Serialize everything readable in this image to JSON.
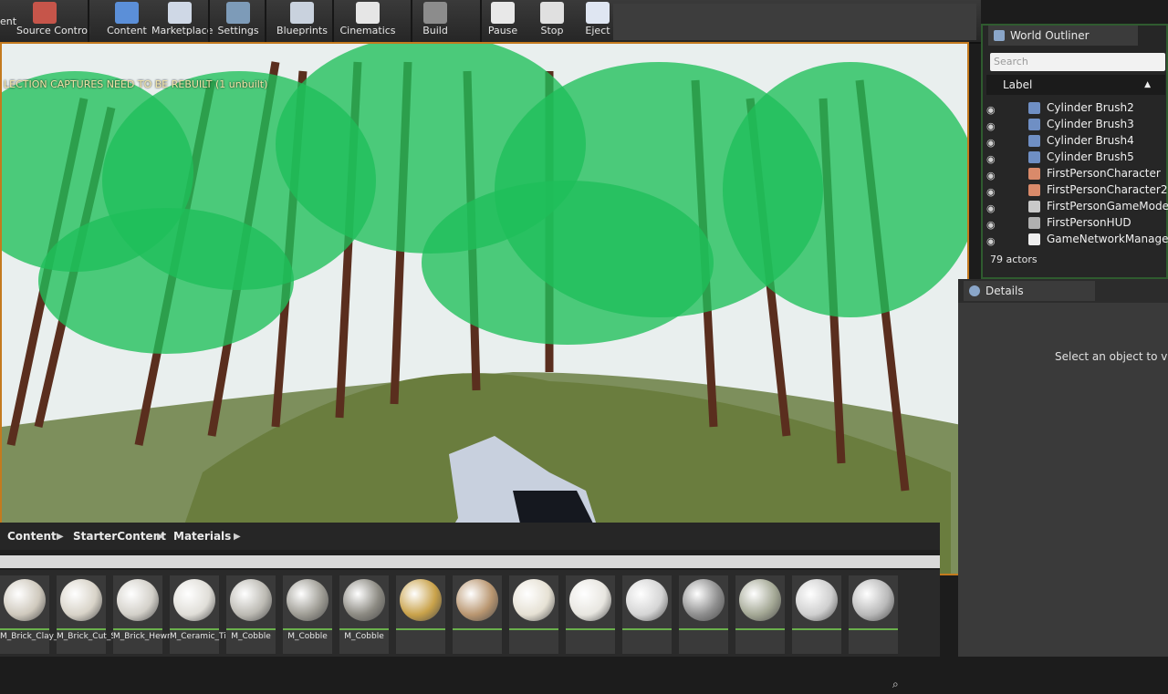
{
  "toolbar": {
    "items": [
      {
        "label": "Source Control",
        "icon": "source-control-icon"
      },
      {
        "label": "Content",
        "icon": "content-icon"
      },
      {
        "label": "Marketplace",
        "icon": "marketplace-icon"
      },
      {
        "label": "Settings",
        "icon": "settings-icon"
      },
      {
        "label": "Blueprints",
        "icon": "blueprints-icon"
      },
      {
        "label": "Cinematics",
        "icon": "cinematics-icon"
      },
      {
        "label": "Build",
        "icon": "build-icon"
      },
      {
        "label": "Pause",
        "icon": "pause-icon"
      },
      {
        "label": "Stop",
        "icon": "stop-icon"
      },
      {
        "label": "Eject",
        "icon": "eject-icon"
      }
    ],
    "cut_label": "ent"
  },
  "viewport": {
    "warning": "LECTION CAPTURES NEED TO BE REBUILT (1 unbuilt)"
  },
  "outliner": {
    "tab_label": "World Outliner",
    "search_placeholder": "Search",
    "column_label": "Label",
    "items": [
      {
        "label": "Cylinder Brush2",
        "icon": "brush-icon"
      },
      {
        "label": "Cylinder Brush3",
        "icon": "brush-icon"
      },
      {
        "label": "Cylinder Brush4",
        "icon": "brush-icon"
      },
      {
        "label": "Cylinder Brush5",
        "icon": "brush-icon"
      },
      {
        "label": "FirstPersonCharacter",
        "icon": "character-icon"
      },
      {
        "label": "FirstPersonCharacter2",
        "icon": "character-icon"
      },
      {
        "label": "FirstPersonGameMode",
        "icon": "gamemode-icon"
      },
      {
        "label": "FirstPersonHUD",
        "icon": "hud-icon"
      },
      {
        "label": "GameNetworkManager",
        "icon": "network-icon"
      }
    ],
    "actor_count": "79 actors"
  },
  "details": {
    "tab_label": "Details",
    "hint": "Select an object to view"
  },
  "content_browser": {
    "breadcrumb": [
      "Content",
      "StarterContent",
      "Materials"
    ],
    "assets": [
      {
        "name": "M_Brick_Clay_Old",
        "color": "#cfc9bd"
      },
      {
        "name": "M_Brick_Cut_Stone",
        "color": "#d8d3c8"
      },
      {
        "name": "M_Brick_Hewn_Stone",
        "color": "#d3d0c9"
      },
      {
        "name": "M_Ceramic_Tile_Checker",
        "color": "#e0ded8"
      },
      {
        "name": "M_Cobble",
        "color": "#bcbab3"
      },
      {
        "name": "M_Cobble",
        "color": "#9e9c94"
      },
      {
        "name": "M_Cobble",
        "color": "#8c8a82"
      },
      {
        "name": "",
        "color": "#c9a24a"
      },
      {
        "name": "",
        "color": "#b99670"
      },
      {
        "name": "",
        "color": "#e6e1d4"
      },
      {
        "name": "",
        "color": "#e8e6e0"
      },
      {
        "name": "",
        "color": "#d5d5d5"
      },
      {
        "name": "",
        "color": "#8e8e8e"
      },
      {
        "name": "",
        "color": "#a4a895"
      },
      {
        "name": "",
        "color": "#cfcfcf"
      },
      {
        "name": "",
        "color": "#b9b9b9"
      }
    ]
  }
}
